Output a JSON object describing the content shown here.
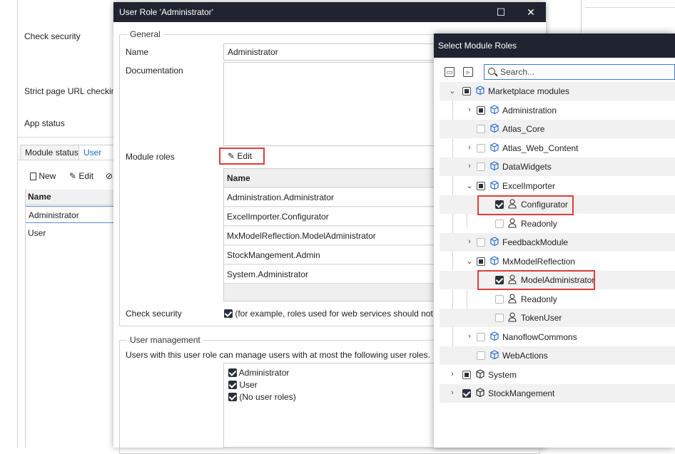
{
  "background_app": {
    "labels": {
      "check_security": "Check security",
      "strict_url": "Strict page URL checking",
      "app_status": "App status"
    },
    "tabs": [
      "Module status",
      "User role"
    ],
    "toolbar": {
      "new": "New",
      "edit": "Edit"
    },
    "grid": {
      "header": "Name",
      "rows": [
        "Administrator",
        "User"
      ]
    }
  },
  "user_role_dialog": {
    "title": "User Role 'Administrator'",
    "general": {
      "group_title": "General",
      "name_label": "Name",
      "name_value": "Administrator",
      "documentation_label": "Documentation",
      "module_roles_label": "Module roles",
      "edit_label": "Edit",
      "table_header": "Name",
      "module_roles": [
        "Administration.Administrator",
        "ExcelImporter.Configurator",
        "MxModelReflection.ModelAdministrator",
        "StockMangement.Admin",
        "System.Administrator"
      ],
      "check_security_label": "Check security",
      "check_security_text": "(for example, roles used for web services should not be"
    },
    "user_management": {
      "group_title": "User management",
      "description": "Users with this user role can manage users with at most the following user roles.",
      "roles": [
        "Administrator",
        "User",
        "(No user roles)"
      ]
    }
  },
  "select_module_roles_dialog": {
    "title": "Select Module Roles",
    "search_placeholder": "Search...",
    "tree": {
      "marketplace": "Marketplace modules",
      "administration": "Administration",
      "atlas_core": "Atlas_Core",
      "atlas_web": "Atlas_Web_Content",
      "datawidgets": "DataWidgets",
      "excelimporter": "ExcelImporter",
      "configurator": "Configurator",
      "readonly1": "Readonly",
      "feedback": "FeedbackModule",
      "mxmodel": "MxModelReflection",
      "modeladmin": "ModelAdministrator",
      "readonly2": "Readonly",
      "tokenuser": "TokenUser",
      "nanoflow": "NanoflowCommons",
      "webactions": "WebActions",
      "system": "System",
      "stock": "StockMangement"
    }
  },
  "colors": {
    "titlebar": "#1f2430",
    "highlight": "#e23c3c",
    "module_icon": "#2f6fd1",
    "selection_border": "#5b8fd6"
  }
}
